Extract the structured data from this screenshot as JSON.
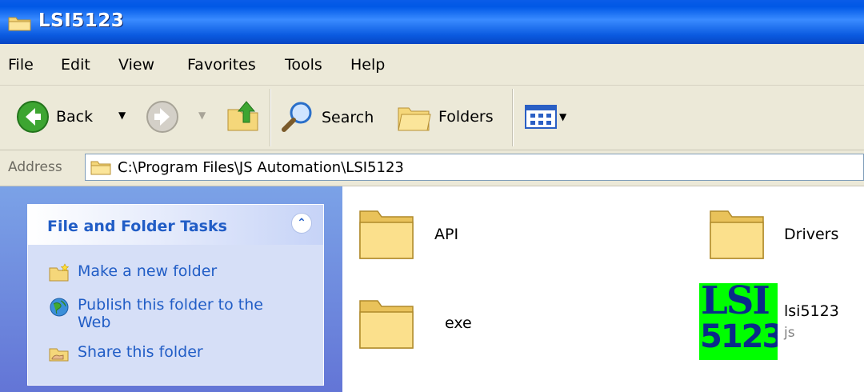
{
  "window": {
    "title": "LSI5123"
  },
  "menubar": {
    "items": [
      "File",
      "Edit",
      "View",
      "Favorites",
      "Tools",
      "Help"
    ]
  },
  "toolbar": {
    "back_label": "Back",
    "search_label": "Search",
    "folders_label": "Folders"
  },
  "address": {
    "label": "Address",
    "path": "C:\\Program Files\\JS Automation\\LSI5123"
  },
  "tasks": {
    "title": "File and Folder Tasks",
    "items": [
      {
        "label": "Make a new folder",
        "icon": "new-folder-icon"
      },
      {
        "label": "Publish this folder to the Web",
        "icon": "publish-web-icon"
      },
      {
        "label": "Share this folder",
        "icon": "share-folder-icon"
      }
    ]
  },
  "files": [
    {
      "name": "API",
      "type": "folder"
    },
    {
      "name": "Drivers",
      "type": "folder"
    },
    {
      "name": "exe",
      "type": "folder"
    },
    {
      "name": "lsi5123",
      "sub": "js",
      "type": "file",
      "icon_text": [
        "LSI",
        "5123"
      ]
    }
  ],
  "colors": {
    "title_bar": "#0058e6",
    "task_link": "#215dc6",
    "task_pane": "#6f8fe0",
    "file_icon_bg": "#00ff00"
  }
}
